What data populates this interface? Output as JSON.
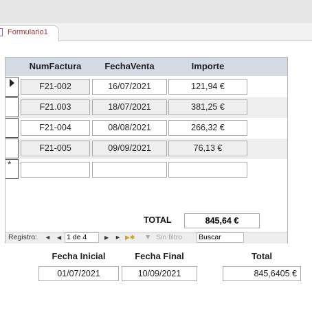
{
  "tab": {
    "label": "Formulario1"
  },
  "subform": {
    "columns": [
      "NumFactura",
      "FechaVenta",
      "Importe"
    ],
    "rows": [
      {
        "num": "F21-002",
        "fecha": "16/07/2021",
        "importe": "121,94 €"
      },
      {
        "num": "F21.003",
        "fecha": "18/07/2021",
        "importe": "381,25 €"
      },
      {
        "num": "F21-004",
        "fecha": "08/08/2021",
        "importe": "266,32 €"
      },
      {
        "num": "F21-005",
        "fecha": "09/09/2021",
        "importe": "76,13 €"
      }
    ],
    "new_row_marker": "*",
    "total_label": "TOTAL",
    "total_value": "845,64 €"
  },
  "navigator": {
    "label": "Registro:",
    "position": "1 de 4",
    "filter_label": "Sin filtro",
    "search_value": "Buscar"
  },
  "footer": {
    "fecha_inicial_label": "Fecha Inicial",
    "fecha_inicial_value": "01/07/2021",
    "fecha_final_label": "Fecha Final",
    "fecha_final_value": "10/09/2021",
    "total_label": "Total",
    "total_value": "845,6405 €"
  }
}
